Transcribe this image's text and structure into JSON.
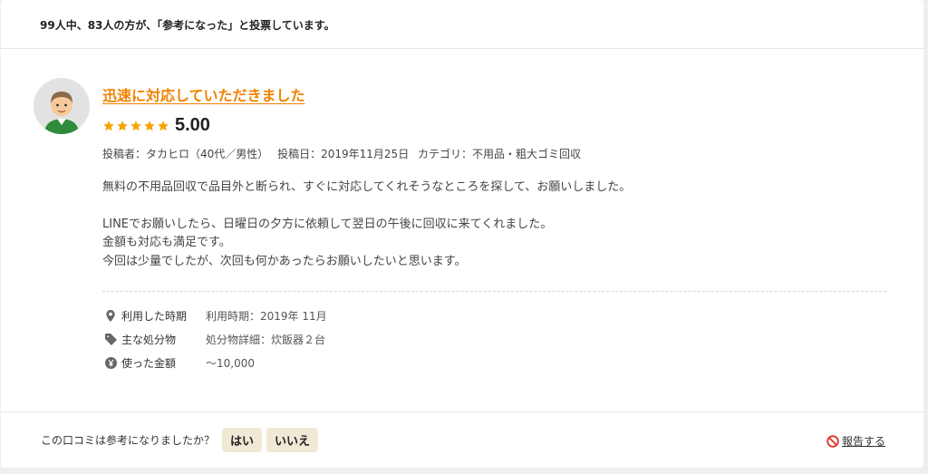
{
  "vote_summary": "99人中、83人の方が、「参考になった」と投票しています。",
  "review": {
    "title": "迅速に対応していただきました",
    "rating": {
      "stars": 5,
      "score": "5.00"
    },
    "meta": {
      "poster": "投稿者：タカヒロ（40代／男性）",
      "date": "投稿日：2019年11月25日",
      "category": "カテゴリ：不用品・粗大ゴミ回収"
    },
    "body": {
      "line1": "無料の不用品回収で品目外と断られ、すぐに対応してくれそうなところを探して、お願いしました。",
      "line2": "LINEでお願いしたら、日曜日の夕方に依頼して翌日の午後に回収に来てくれました。",
      "line3": "金額も対応も満足です。",
      "line4": "今回は少量でしたが、次回も何かあったらお願いしたいと思います。"
    },
    "details": {
      "period_label": "利用した時期",
      "period_value": "利用時期：2019年 11月",
      "items_label": "主な処分物",
      "items_value": "処分物詳細：炊飯器２台",
      "price_label": "使った金額",
      "price_value": "～10,000"
    }
  },
  "helpful": {
    "question": "この口コミは参考になりましたか？",
    "yes_label": "はい",
    "no_label": "いいえ"
  },
  "report_label": "報告する",
  "colors": {
    "accent": "#f08300",
    "star": "#f4a300",
    "button_bg": "#f1e8d6"
  },
  "icons": [
    "avatar-icon",
    "star-icon",
    "location-pin-icon",
    "tag-icon",
    "yen-icon",
    "prohibited-icon"
  ]
}
